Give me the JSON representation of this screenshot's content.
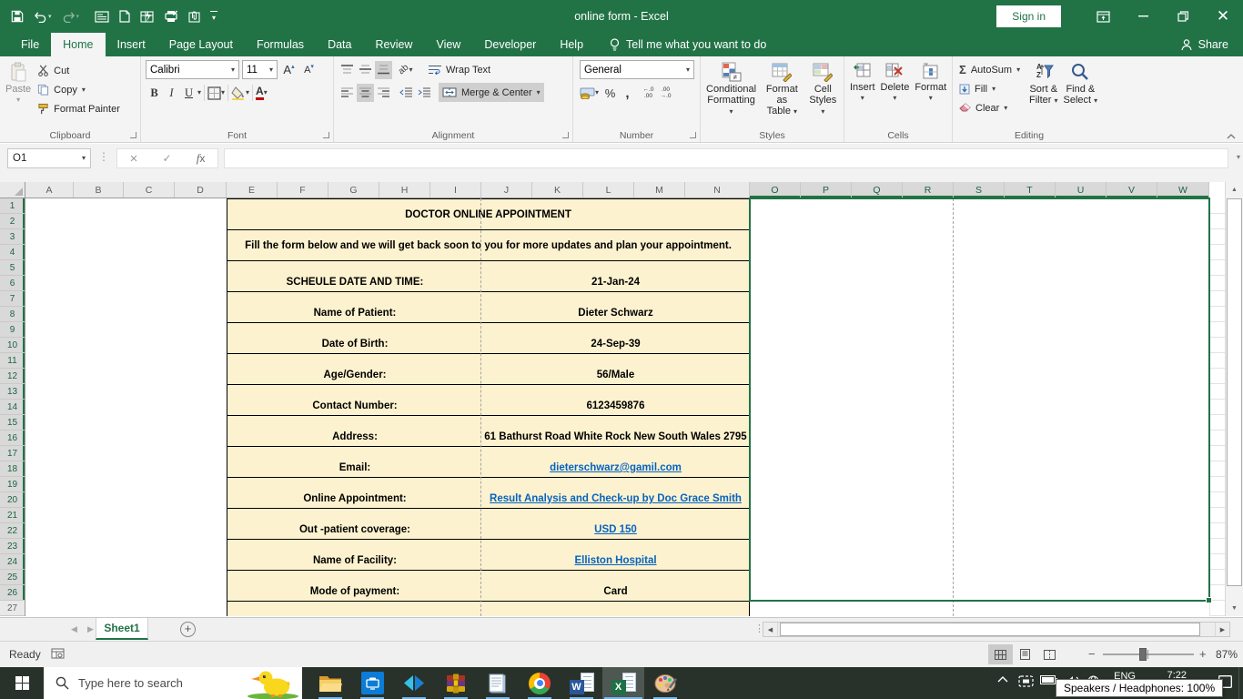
{
  "window": {
    "title": "online form  -  Excel",
    "sign_in_label": "Sign in",
    "qat_icons": [
      "save",
      "undo",
      "redo",
      "form-view",
      "new-file",
      "quick-analysis",
      "print-preview",
      "attachment",
      "customize-qat"
    ],
    "controls": [
      "ribbon-display-options",
      "minimize",
      "restore",
      "close"
    ]
  },
  "tabs": {
    "items": [
      {
        "label": "File"
      },
      {
        "label": "Home"
      },
      {
        "label": "Insert"
      },
      {
        "label": "Page Layout"
      },
      {
        "label": "Formulas"
      },
      {
        "label": "Data"
      },
      {
        "label": "Review"
      },
      {
        "label": "View"
      },
      {
        "label": "Developer"
      },
      {
        "label": "Help"
      }
    ],
    "active": "Home",
    "tell_me": "Tell me what you want to do",
    "share": "Share"
  },
  "ribbon": {
    "clipboard": {
      "group": "Clipboard",
      "paste": "Paste",
      "cut": "Cut",
      "copy": "Copy",
      "format_painter": "Format Painter"
    },
    "font": {
      "group": "Font",
      "family": "Calibri",
      "size": "11"
    },
    "alignment": {
      "group": "Alignment",
      "wrap_text": "Wrap Text",
      "merge_center": "Merge & Center"
    },
    "number": {
      "group": "Number",
      "format": "General"
    },
    "styles": {
      "group": "Styles",
      "conditional_1": "Conditional",
      "conditional_2": "Formatting",
      "format_table_1": "Format as",
      "format_table_2": "Table",
      "cell_styles_1": "Cell",
      "cell_styles_2": "Styles"
    },
    "cells": {
      "group": "Cells",
      "insert": "Insert",
      "delete": "Delete",
      "format": "Format"
    },
    "editing": {
      "group": "Editing",
      "autosum": "AutoSum",
      "fill": "Fill",
      "clear": "Clear",
      "sort_1": "Sort &",
      "sort_2": "Filter",
      "find_1": "Find &",
      "find_2": "Select"
    }
  },
  "formula_bar": {
    "name_box": "O1",
    "formula": ""
  },
  "grid": {
    "columns": [
      {
        "letter": "A",
        "w": 53
      },
      {
        "letter": "B",
        "w": 55
      },
      {
        "letter": "C",
        "w": 56
      },
      {
        "letter": "D",
        "w": 57
      },
      {
        "letter": "E",
        "w": 56
      },
      {
        "letter": "F",
        "w": 56
      },
      {
        "letter": "G",
        "w": 56
      },
      {
        "letter": "H",
        "w": 56
      },
      {
        "letter": "I",
        "w": 56
      },
      {
        "letter": "J",
        "w": 56
      },
      {
        "letter": "K",
        "w": 56
      },
      {
        "letter": "L",
        "w": 56
      },
      {
        "letter": "M",
        "w": 56
      },
      {
        "letter": "N",
        "w": 71
      },
      {
        "letter": "O",
        "w": 56,
        "selected": true
      },
      {
        "letter": "P",
        "w": 56,
        "selected": true
      },
      {
        "letter": "Q",
        "w": 56,
        "selected": true
      },
      {
        "letter": "R",
        "w": 56,
        "selected": true
      },
      {
        "letter": "S",
        "w": 56,
        "selected": true
      },
      {
        "letter": "T",
        "w": 56,
        "selected": true
      },
      {
        "letter": "U",
        "w": 56,
        "selected": true
      },
      {
        "letter": "V",
        "w": 56,
        "selected": true
      },
      {
        "letter": "W",
        "w": 57,
        "selected": true
      }
    ],
    "row_count": 27,
    "selected_rows_through": 26,
    "selected_range": "O1:W26"
  },
  "form": {
    "title": "DOCTOR ONLINE APPOINTMENT",
    "subtitle": "Fill the form below and we will get back soon to you for more updates and plan your appointment.",
    "fields": [
      {
        "label": "SCHEULE DATE AND TIME:",
        "value": "21-Jan-24",
        "link": false
      },
      {
        "label": "Name of Patient:",
        "value": "Dieter Schwarz",
        "link": false
      },
      {
        "label": "Date of Birth:",
        "value": "24-Sep-39",
        "link": false
      },
      {
        "label": "Age/Gender:",
        "value": "56/Male",
        "link": false
      },
      {
        "label": "Contact Number:",
        "value": "6123459876",
        "link": false
      },
      {
        "label": "Address:",
        "value": "61 Bathurst Road  White Rock New South Wales 2795",
        "link": false
      },
      {
        "label": "Email:",
        "value": "dieterschwarz@gamil.com",
        "link": true
      },
      {
        "label": "Online Appointment:",
        "value": "Result Analysis and Check-up by Doc Grace Smith",
        "link": true
      },
      {
        "label": "Out -patient coverage:",
        "value": "USD 150",
        "link": true
      },
      {
        "label": "Name of Facility:",
        "value": "Elliston Hospital",
        "link": true
      },
      {
        "label": "Mode of payment:",
        "value": "Card",
        "link": false
      }
    ]
  },
  "sheet_bar": {
    "tab": "Sheet1"
  },
  "status_bar": {
    "mode": "Ready",
    "zoom_level": "87%",
    "views": [
      "normal-view",
      "page-layout-view",
      "page-break-preview"
    ]
  },
  "taskbar": {
    "search_placeholder": "Type here to search",
    "apps": [
      "file-explorer",
      "remote-desktop",
      "code-tool",
      "winrar",
      "notepad",
      "chrome",
      "word",
      "excel",
      "paint"
    ],
    "active_app": "excel",
    "tray": {
      "language": "ENG",
      "time": "7:22 pm",
      "tooltip": "Speakers / Headphones: 100%"
    }
  },
  "colors": {
    "excel_green": "#217346",
    "form_fill": "#FDF2CF",
    "hyperlink": "#0563C1",
    "selection_border": "#217346",
    "taskbar_underline": "#79B8EA"
  }
}
